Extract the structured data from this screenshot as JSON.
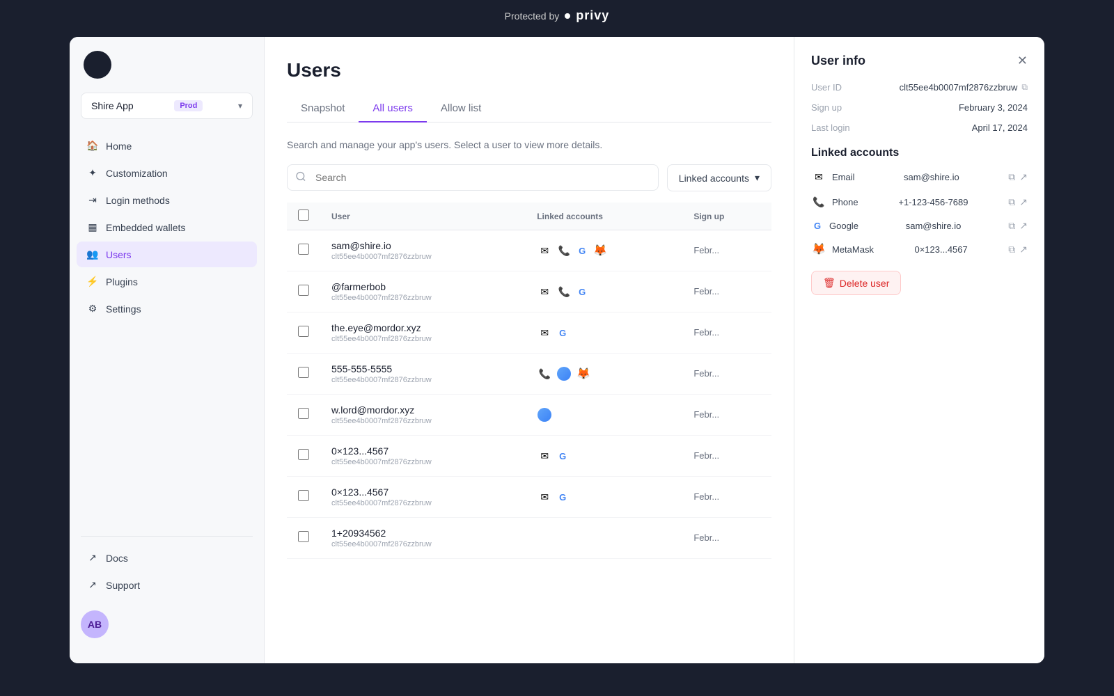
{
  "topbar": {
    "protected_text": "Protected by",
    "privy_text": "privy"
  },
  "sidebar": {
    "app_name": "Shire App",
    "app_env": "Prod",
    "nav_items": [
      {
        "id": "home",
        "label": "Home",
        "icon": "🏠"
      },
      {
        "id": "customization",
        "label": "Customization",
        "icon": "✦"
      },
      {
        "id": "login-methods",
        "label": "Login methods",
        "icon": "→"
      },
      {
        "id": "embedded-wallets",
        "label": "Embedded wallets",
        "icon": "▦"
      },
      {
        "id": "users",
        "label": "Users",
        "icon": "👥",
        "active": true
      },
      {
        "id": "plugins",
        "label": "Plugins",
        "icon": "⚡"
      },
      {
        "id": "settings",
        "label": "Settings",
        "icon": "⚙"
      }
    ],
    "bottom_items": [
      {
        "id": "docs",
        "label": "Docs",
        "icon": "↗"
      },
      {
        "id": "support",
        "label": "Support",
        "icon": "↗"
      }
    ],
    "user_initials": "AB"
  },
  "main": {
    "page_title": "Users",
    "description": "Search and manage your app's users. Select a user to view more details.",
    "tabs": [
      {
        "id": "snapshot",
        "label": "Snapshot"
      },
      {
        "id": "all-users",
        "label": "All users",
        "active": true
      },
      {
        "id": "allow-list",
        "label": "Allow list"
      }
    ],
    "search_placeholder": "Search",
    "filter_label": "Linked accounts",
    "table": {
      "headers": [
        "User",
        "Linked accounts",
        "Sign up"
      ],
      "rows": [
        {
          "name": "sam@shire.io",
          "id": "clt55ee4b0007mf2876zzbruw",
          "icons": [
            "email",
            "phone",
            "google",
            "metamask"
          ],
          "date": "Febr..."
        },
        {
          "name": "@farmerbob",
          "id": "clt55ee4b0007mf2876zzbruw",
          "icons": [
            "email",
            "phone",
            "google"
          ],
          "date": "Febr..."
        },
        {
          "name": "the.eye@mordor.xyz",
          "id": "clt55ee4b0007mf2876zzbruw",
          "icons": [
            "email",
            "google"
          ],
          "date": "Febr..."
        },
        {
          "name": "555-555-5555",
          "id": "clt55ee4b0007mf2876zzbruw",
          "icons": [
            "phone",
            "circle",
            "metamask"
          ],
          "date": "Febr..."
        },
        {
          "name": "w.lord@mordor.xyz",
          "id": "clt55ee4b0007mf2876zzbruw",
          "icons": [
            "circle"
          ],
          "date": "Febr..."
        },
        {
          "name": "0×123...4567",
          "id": "clt55ee4b0007mf2876zzbruw",
          "icons": [
            "email",
            "google"
          ],
          "date": "Febr..."
        },
        {
          "name": "0×123...4567",
          "id": "clt55ee4b0007mf2876zzbruw",
          "icons": [
            "email",
            "google"
          ],
          "date": "Febr..."
        },
        {
          "name": "1+20934562",
          "id": "clt55ee4b0007mf2876zzbruw",
          "icons": [],
          "date": "Febr..."
        }
      ]
    }
  },
  "user_info": {
    "panel_title": "User info",
    "user_id_label": "User ID",
    "user_id_value": "clt55ee4b0007mf2876zzbruw",
    "signup_label": "Sign up",
    "signup_value": "February 3, 2024",
    "last_login_label": "Last login",
    "last_login_value": "April 17, 2024",
    "linked_section": "Linked accounts",
    "linked_accounts": [
      {
        "type": "Email",
        "icon": "email",
        "value": "sam@shire.io"
      },
      {
        "type": "Phone",
        "icon": "phone",
        "value": "+1-123-456-7689"
      },
      {
        "type": "Google",
        "icon": "google",
        "value": "sam@shire.io"
      },
      {
        "type": "MetaMask",
        "icon": "metamask",
        "value": "0×123...4567"
      }
    ],
    "delete_label": "Delete user"
  }
}
